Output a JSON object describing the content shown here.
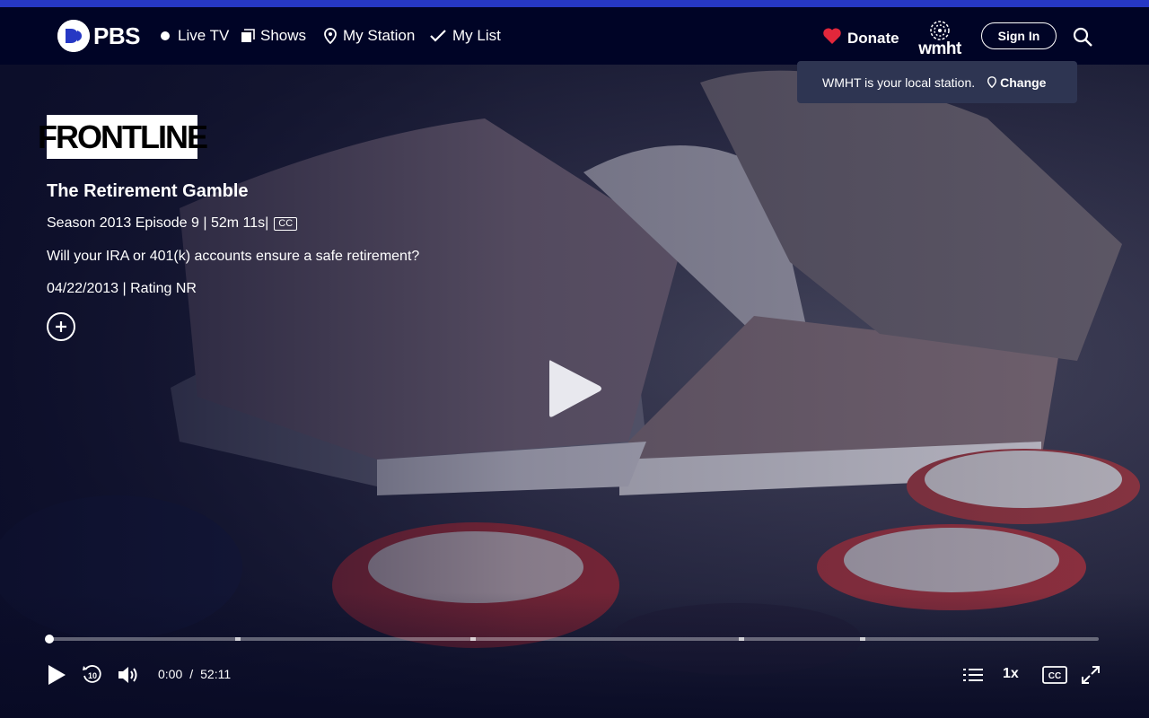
{
  "nav": {
    "logo_text": "PBS",
    "items": [
      {
        "label": "Live TV",
        "icon": "live-dot-icon"
      },
      {
        "label": "Shows",
        "icon": "shows-icon"
      },
      {
        "label": "My Station",
        "icon": "location-pin-icon"
      },
      {
        "label": "My List",
        "icon": "checkmark-icon"
      }
    ],
    "donate_label": "Donate",
    "station_logo_text": "wmht",
    "signin_label": "Sign In"
  },
  "tooltip": {
    "message": "WMHT is your local station.",
    "change_label": "Change"
  },
  "episode": {
    "show_logo_text": "FRONTLINE",
    "title": "The Retirement Gamble",
    "season_info": "Season 2013 Episode 9 | 52m 11s|",
    "cc_badge": "CC",
    "description": "Will your IRA or 401(k) accounts ensure a safe retirement?",
    "date_rating": "04/22/2013 | Rating NR"
  },
  "player": {
    "current_time": "0:00",
    "separator": "/",
    "duration": "52:11",
    "speed_label": "1x",
    "progress_fraction": 0
  },
  "colors": {
    "top_accent": "#2638c4",
    "nav_bg": "#000426",
    "donate_heart": "#e2273b",
    "tooltip_bg": "#2e3552"
  }
}
